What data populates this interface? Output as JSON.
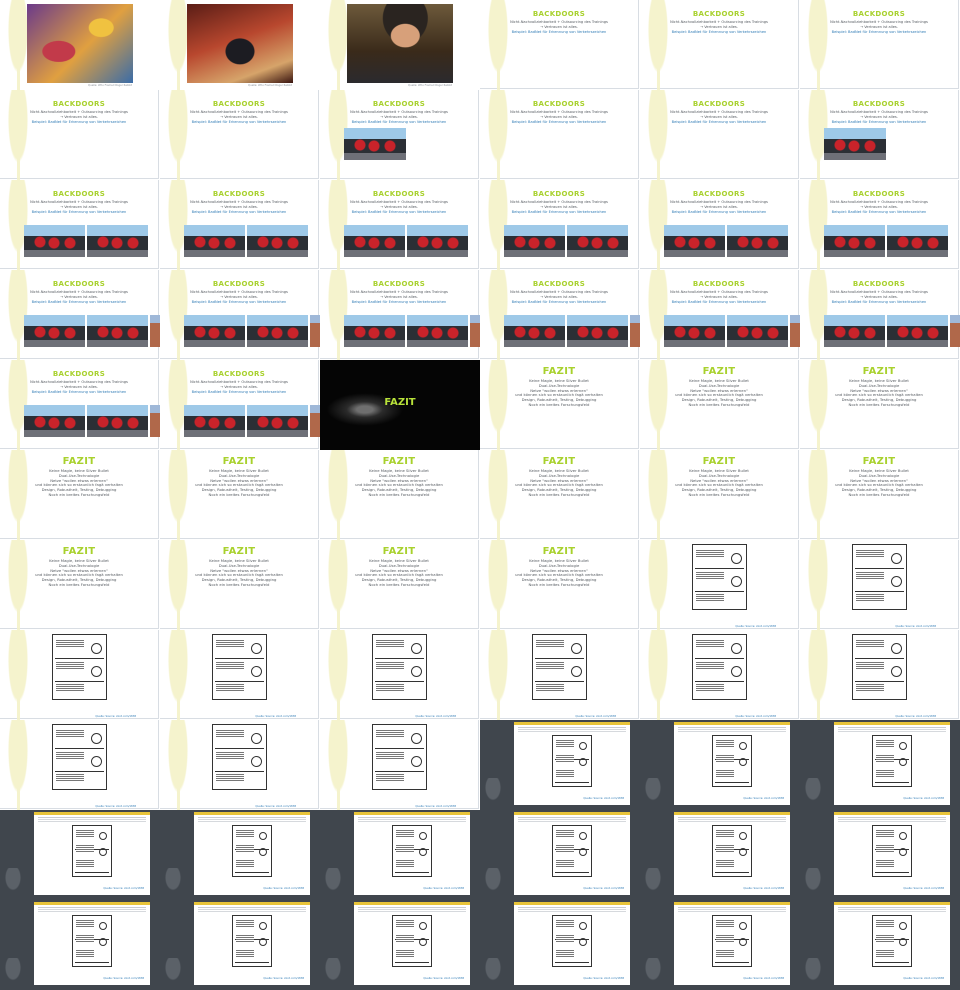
{
  "photo_caption": "Quelle: Who Framed Roger Rabbit",
  "backdoors": {
    "title": "BACKDOORS",
    "line1": "Nicht-Nachvollziehbarkeit + Outsourcing des Trainings",
    "line2": "→ Vertrauen ist alles.",
    "line3": "Beispiel: BadNet für Erkennung von Verkehrszeichen"
  },
  "noir_title": "FAZIT",
  "fazit": {
    "title": "FAZIT",
    "lines": [
      "Keine Magie, keine Silver Bullet",
      "Dual-Use-Technologie",
      "Netze \"wollen etwas erlernen\"",
      "und können sich so erstaunlich fagä verhalten",
      "Design, Robustheit, Testing, Debugging",
      "Noch ein breites Forschungsfeld"
    ]
  },
  "comic_source": "Quelle: Source: xkcd.com/1838",
  "grid": {
    "columns": 6,
    "rows": 11
  },
  "slides": [
    "photo1",
    "photo2",
    "photo3",
    "bd-plain",
    "bd-plain",
    "bd-plain",
    "bd-plain",
    "bd-plain",
    "bd-stop1",
    "bd-plain",
    "bd-plain",
    "bd-stop1",
    "bd-stop2",
    "bd-stop2",
    "bd-stop2",
    "bd-stop2",
    "bd-stop2",
    "bd-stop2",
    "bd-street",
    "bd-street",
    "bd-street",
    "bd-street",
    "bd-street",
    "bd-street",
    "bd-street",
    "bd-street",
    "noir",
    "fazit",
    "fazit",
    "fazit",
    "fazit",
    "fazit",
    "fazit",
    "fazit",
    "fazit",
    "fazit",
    "fazit",
    "fazit",
    "fazit",
    "fazit",
    "comic",
    "comic",
    "comic",
    "comic",
    "comic",
    "comic",
    "comic",
    "comic",
    "comic",
    "comic",
    "comic",
    "shot",
    "shot",
    "shot",
    "shot",
    "shot",
    "shot",
    "shot",
    "shot",
    "shot",
    "shot",
    "shot",
    "shot",
    "shot",
    "shot",
    "shot"
  ]
}
